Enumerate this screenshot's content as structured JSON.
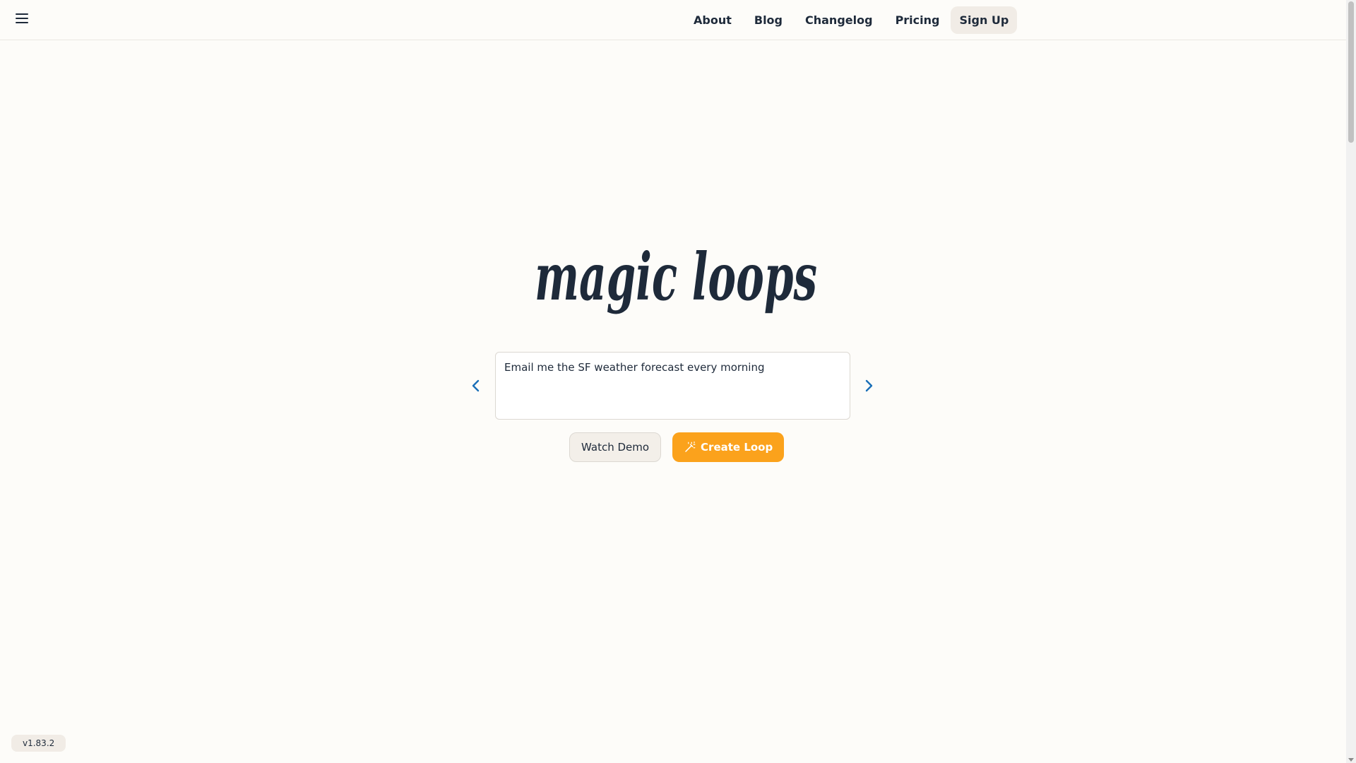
{
  "header": {
    "menu_icon": "hamburger-menu-icon",
    "nav": {
      "about": "About",
      "blog": "Blog",
      "changelog": "Changelog",
      "pricing": "Pricing",
      "signup": "Sign Up"
    }
  },
  "hero": {
    "logo_text": "magic loops",
    "prompt_value": "Email me the SF weather forecast every morning",
    "prev_icon": "chevron-left-icon",
    "next_icon": "chevron-right-icon",
    "watch_demo_label": "Watch Demo",
    "create_loop_label": "Create Loop",
    "create_loop_icon": "magic-wand-icon"
  },
  "footer": {
    "version": "v1.83.2"
  },
  "colors": {
    "background": "#fdfcf9",
    "text": "#1e2a3a",
    "accent": "#fba21c",
    "arrow": "#1a6fb8",
    "button_secondary": "#f3efe9"
  }
}
